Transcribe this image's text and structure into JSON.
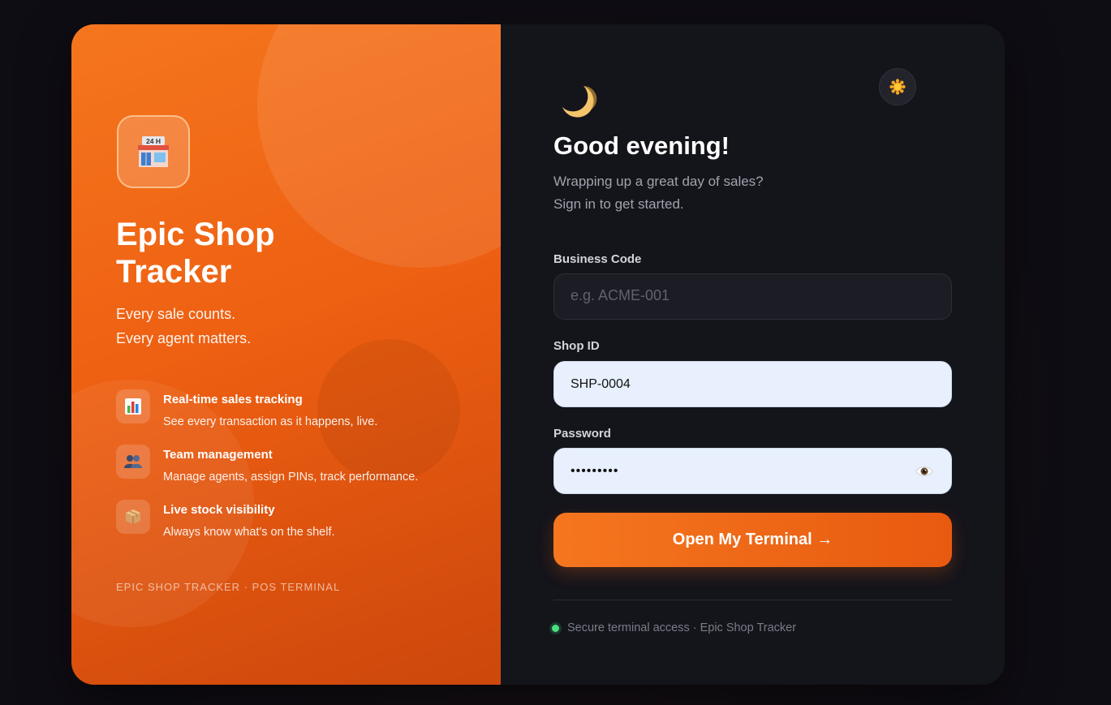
{
  "brand": {
    "name": "Epic Shop Tracker",
    "tagline": [
      "Every sale counts.",
      "Every agent matters."
    ],
    "footer": "EPIC SHOP TRACKER · POS TERMINAL"
  },
  "features": [
    {
      "icon": "bar-chart-icon",
      "title": "Real-time sales tracking",
      "desc": "See every transaction as it happens, live."
    },
    {
      "icon": "people-icon",
      "title": "Team management",
      "desc": "Manage agents, assign PINs, track performance."
    },
    {
      "icon": "package-icon",
      "title": "Live stock visibility",
      "desc": "Always know what's on the shelf."
    }
  ],
  "login": {
    "greeting": "Good evening!",
    "subtitle": [
      "Wrapping up a great day of sales?",
      "Sign in to get started."
    ],
    "business_code": {
      "label": "Business Code",
      "placeholder": "e.g. ACME-001",
      "value": ""
    },
    "shop_id": {
      "label": "Shop ID",
      "value": "SHP-0004"
    },
    "password": {
      "label": "Password",
      "value": "•••••••••"
    },
    "submit_label": "Open My Terminal →",
    "secure_note": "Secure terminal access · Epic Shop Tracker"
  },
  "colors": {
    "accent": "#f26b1a",
    "status_ok": "#4ade80",
    "panel_bg": "#14141b"
  }
}
